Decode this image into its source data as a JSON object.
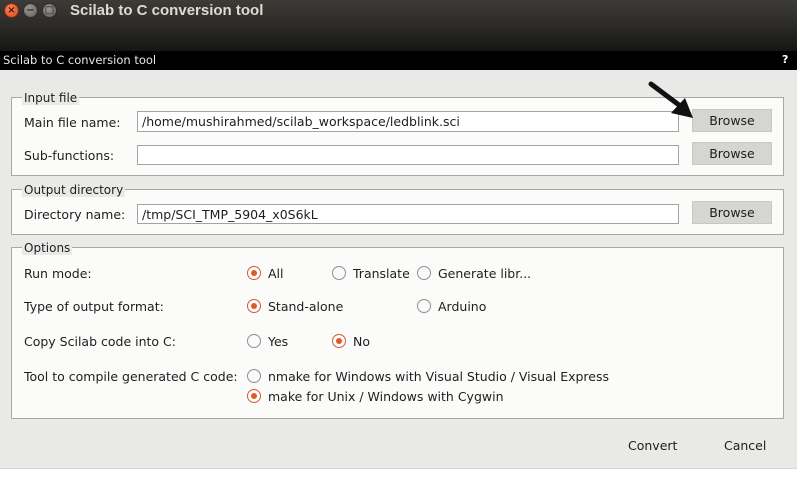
{
  "window": {
    "title": "Scilab to C conversion tool",
    "frame_title": "Scilab to C conversion tool",
    "help": "?"
  },
  "input_file": {
    "legend": "Input file",
    "main_file_label": "Main file name:",
    "main_file_value": "/home/mushirahmed/scilab_workspace/ledblink.sci",
    "subfunctions_label": "Sub-functions:",
    "subfunctions_value": "",
    "browse1": "Browse",
    "browse2": "Browse"
  },
  "output_directory": {
    "legend": "Output directory",
    "dir_label": "Directory name:",
    "dir_value": "/tmp/SCI_TMP_5904_x0S6kL",
    "browse": "Browse"
  },
  "options": {
    "legend": "Options",
    "run_mode_label": "Run mode:",
    "run_mode_options": [
      "All",
      "Translate",
      "Generate libr..."
    ],
    "run_mode_selected": "All",
    "output_format_label": "Type of output format:",
    "output_format_options": [
      "Stand-alone",
      "Arduino"
    ],
    "output_format_selected": "Stand-alone",
    "copy_code_label": "Copy Scilab code into C:",
    "copy_code_options": [
      "Yes",
      "No"
    ],
    "copy_code_selected": "No",
    "compile_tool_label": "Tool to compile generated C code:",
    "compile_tool_options": [
      "nmake for Windows with Visual Studio / Visual Express",
      "make for Unix / Windows with Cygwin"
    ],
    "compile_tool_selected": "make for Unix / Windows with Cygwin"
  },
  "footer": {
    "convert": "Convert",
    "cancel": "Cancel"
  },
  "colors": {
    "accent": "#e2582a",
    "titlebar": "#3c3b37",
    "panel": "#e9e9e8"
  }
}
